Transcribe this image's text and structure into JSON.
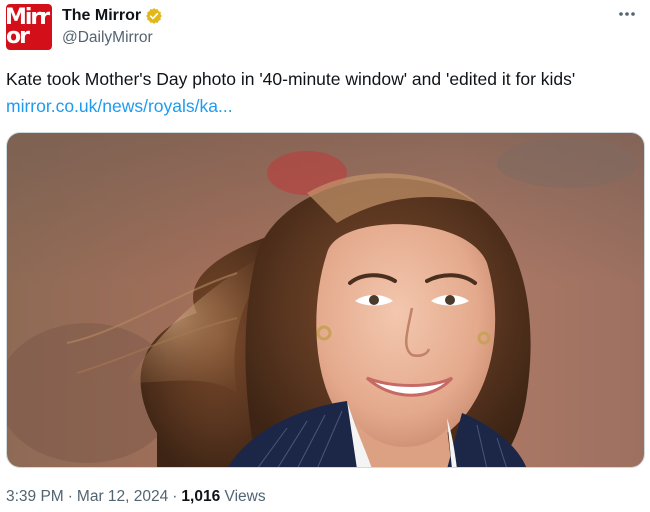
{
  "author": {
    "avatar_text_line1": "Mirr",
    "avatar_text_line2": "or",
    "display_name": "The Mirror",
    "handle": "@DailyMirror",
    "verified_badge_color": "#e2b719"
  },
  "tweet": {
    "text": "Kate took Mother's Day photo in '40-minute window' and 'edited it for kids'",
    "link_text": "mirror.co.uk/news/royals/ka...",
    "link_color": "#1d9bf0"
  },
  "media": {
    "icon": "photo"
  },
  "meta": {
    "time": "3:39 PM",
    "date": "Mar 12, 2024",
    "separator": "·",
    "views_count": "1,016",
    "views_label": "Views"
  }
}
